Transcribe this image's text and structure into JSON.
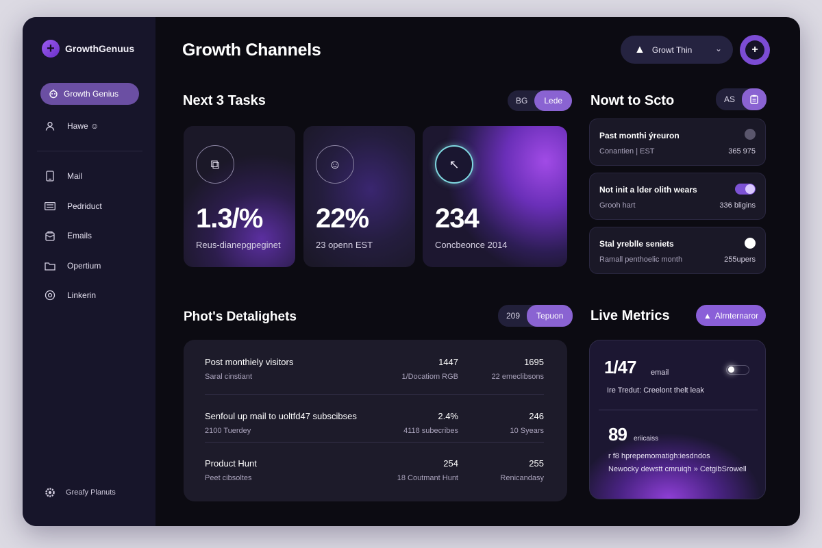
{
  "brand": {
    "name": "GrowthGenuus",
    "icon": "plus-icon"
  },
  "sidebar": {
    "active": {
      "label": "Growth Genius",
      "icon": "robot-icon"
    },
    "items": [
      {
        "label": "Hawe ☺",
        "icon": "user-icon"
      },
      {
        "label": "Mail",
        "icon": "phone-icon"
      },
      {
        "label": "Pedriduct",
        "icon": "list-icon"
      },
      {
        "label": "Emails",
        "icon": "envelope-icon"
      },
      {
        "label": "Opertium",
        "icon": "folder-icon"
      },
      {
        "label": "Linkerin",
        "icon": "at-icon"
      }
    ],
    "bottom": {
      "label": "Greafy Planuts",
      "icon": "gear-icon"
    }
  },
  "header": {
    "title": "Growth Channels",
    "workspace": "Growt Thin",
    "add_label": "+"
  },
  "tasks_section": {
    "title": "Next 3 Tasks",
    "toggle": [
      "BG",
      "Lede"
    ],
    "cards": [
      {
        "value": "1.3/%",
        "label": "Reus-dianepgpeginet",
        "icon": "link-icon"
      },
      {
        "value": "22%",
        "label": "23 openn EST",
        "icon": "chat-icon"
      },
      {
        "value": "234",
        "label": "Concbeonce 2014",
        "icon": "cursor-icon"
      }
    ]
  },
  "howto_section": {
    "title": "Nowt to Scto",
    "toggle_left": "AS",
    "items": [
      {
        "title": "Past monthi ýreuron",
        "sub": "Conantien | EST",
        "meta": "365 975",
        "control": "dot-gray"
      },
      {
        "title": "Not init a lder olith wears",
        "sub": "Grooh hart",
        "meta": "336 bligins",
        "control": "toggle-on"
      },
      {
        "title": "Stal yreblle seniets",
        "sub": "Ramall penthoelic month",
        "meta": "255upers",
        "control": "dot-white"
      }
    ]
  },
  "highlights_section": {
    "title": "Phot's Detalighets",
    "toggle": [
      "209",
      "Tepuon"
    ],
    "rows": [
      {
        "title": "Post monthiely visitors",
        "sub": "Saral cinstiant",
        "v1": "1447",
        "s1": "1/Docatiom RGB",
        "v2": "1695",
        "s2": "22 emeclibsons"
      },
      {
        "title": "Senfoul up mail to uoltfd47 subscibses",
        "sub": "2100 Tuerdey",
        "v1": "2.4%",
        "s1": "4118 subecribes",
        "v2": "246",
        "s2": "10 Syears"
      },
      {
        "title": "Product Hunt",
        "sub": "Peet cibsoltes",
        "v1": "254",
        "s1": "18 Coutmant Hunt",
        "v2": "255",
        "s2": "Renicandasy"
      }
    ]
  },
  "live_metrics": {
    "title": "Live Metrics",
    "button": "Alrnternaror",
    "m1": {
      "value": "1/47",
      "unit": "email",
      "desc": "Ire Tredut: Creelont thelt leak"
    },
    "m2": {
      "value": "89",
      "unit": "eriicaiss",
      "desc1": "r f8 hprepemomatigh:iesdndos",
      "desc2": "Newocky dewstt cmruiqh » CetgibSrowell"
    }
  },
  "colors": {
    "accent": "#8a63d2",
    "bg": "#0c0b12",
    "sidebar": "#17152a"
  }
}
